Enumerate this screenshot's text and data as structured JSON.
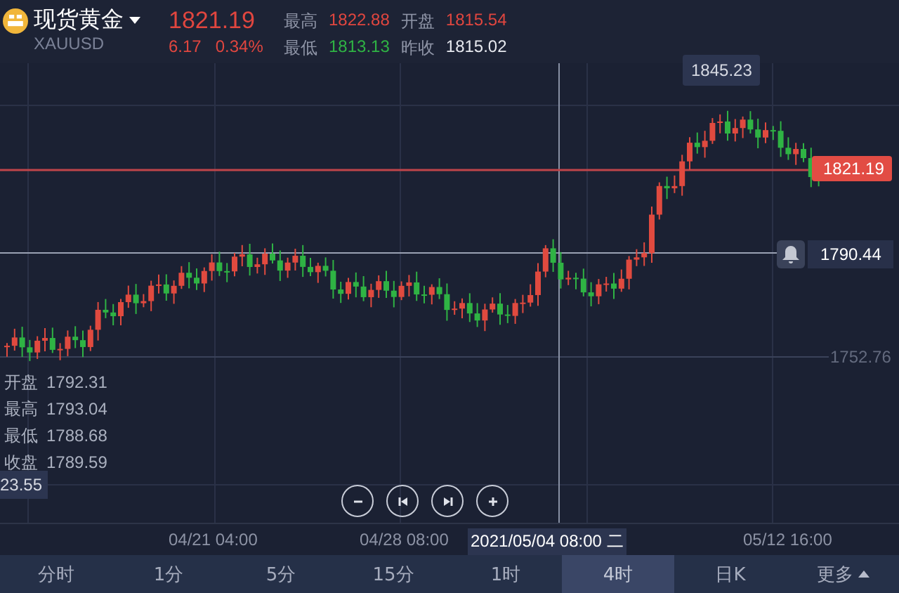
{
  "instrument": {
    "name": "现货黄金",
    "symbol": "XAUUSD",
    "price": "1821.19",
    "change": "6.17",
    "change_pct": "0.34%"
  },
  "stats": [
    {
      "label": "最高",
      "value": "1822.88",
      "color": "#e0463f"
    },
    {
      "label": "最低",
      "value": "1813.13",
      "color": "#2fb344"
    },
    {
      "label": "开盘",
      "value": "1815.54",
      "color": "#e0463f"
    },
    {
      "label": "昨收",
      "value": "1815.02",
      "color": "#e6e8ee"
    }
  ],
  "chart": {
    "price_labels": [
      {
        "kind": "peak",
        "text": "1845.23"
      },
      {
        "kind": "current",
        "text": "1821.19"
      },
      {
        "kind": "alert",
        "text": "1790.44"
      },
      {
        "kind": "axis",
        "text": "1752.76"
      },
      {
        "kind": "cursor",
        "text": "23.55"
      }
    ],
    "ohlc": [
      {
        "label": "开盘",
        "value": "1792.31"
      },
      {
        "label": "最高",
        "value": "1793.04"
      },
      {
        "label": "最低",
        "value": "1788.68"
      },
      {
        "label": "收盘",
        "value": "1789.59"
      }
    ]
  },
  "time_axis": [
    {
      "text": "04/21 04:00",
      "selected": false
    },
    {
      "text": "04/28 08:00",
      "selected": false
    },
    {
      "text": "2021/05/04 08:00 二",
      "selected": true
    },
    {
      "text": "05/12 16:00",
      "selected": false
    }
  ],
  "periods": [
    {
      "label": "分时",
      "selected": false,
      "kind": "plain"
    },
    {
      "label": "1分",
      "selected": false,
      "kind": "plain"
    },
    {
      "label": "5分",
      "selected": false,
      "kind": "plain"
    },
    {
      "label": "15分",
      "selected": false,
      "kind": "plain"
    },
    {
      "label": "1时",
      "selected": false,
      "kind": "plain"
    },
    {
      "label": "4时",
      "selected": true,
      "kind": "plain"
    },
    {
      "label": "日K",
      "selected": false,
      "kind": "plain"
    },
    {
      "label": "更多",
      "selected": false,
      "kind": "menu"
    }
  ]
}
